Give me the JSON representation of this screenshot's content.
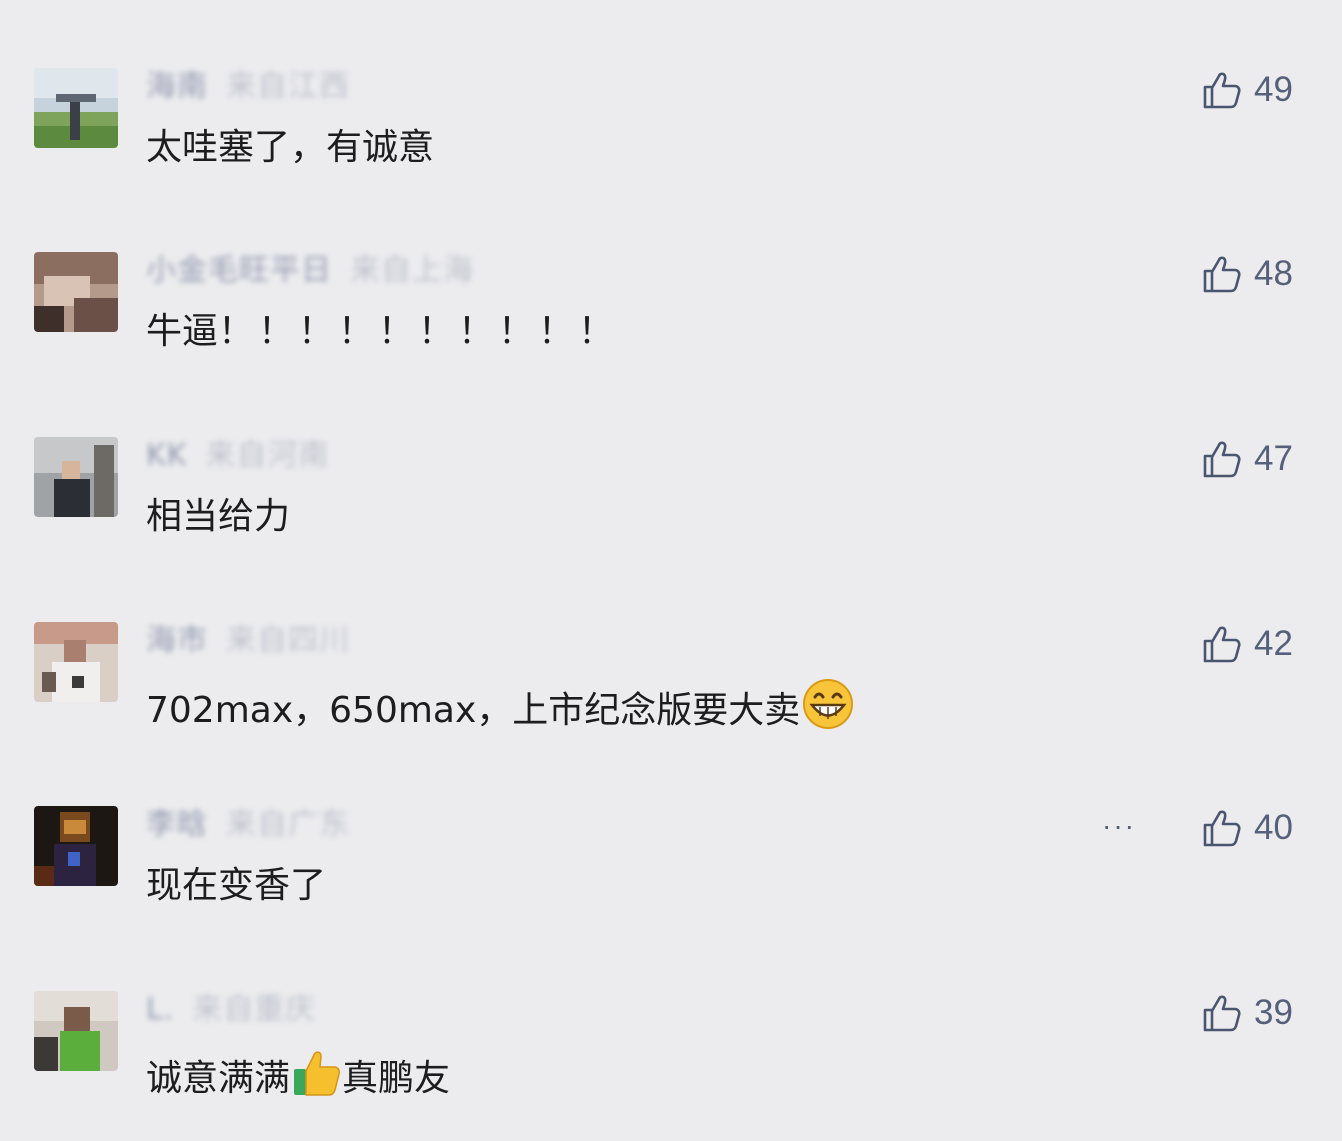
{
  "comments": [
    {
      "name": "海南",
      "location": "来自江西",
      "text": "太哇塞了，有诚意",
      "likes": "49"
    },
    {
      "name": "小金毛旺平日",
      "location": "来自上海",
      "text_before": "牛逼",
      "text_exclaims": "！！！！！！！！！！",
      "likes": "48"
    },
    {
      "name": "KK",
      "location": "来自河南",
      "text": "相当给力",
      "likes": "47"
    },
    {
      "name": "海市",
      "location": "来自四川",
      "text": "702max，650max，上市纪念版要大卖",
      "emoji": "grin-emoji",
      "likes": "42"
    },
    {
      "name": "李晗",
      "location": "来自广东",
      "text": "现在变香了",
      "more": "···",
      "likes": "40"
    },
    {
      "name": "L.",
      "location": "来自重庆",
      "text_before": "诚意满满",
      "emoji": "thumbs-up-emoji",
      "text_after": "真鹏友",
      "likes": "39"
    }
  ],
  "colors": {
    "background": "#ececef",
    "like_icon": "#4a5570",
    "like_count": "#56607a"
  },
  "icons": {
    "like": "thumbs-up-outline-icon"
  }
}
